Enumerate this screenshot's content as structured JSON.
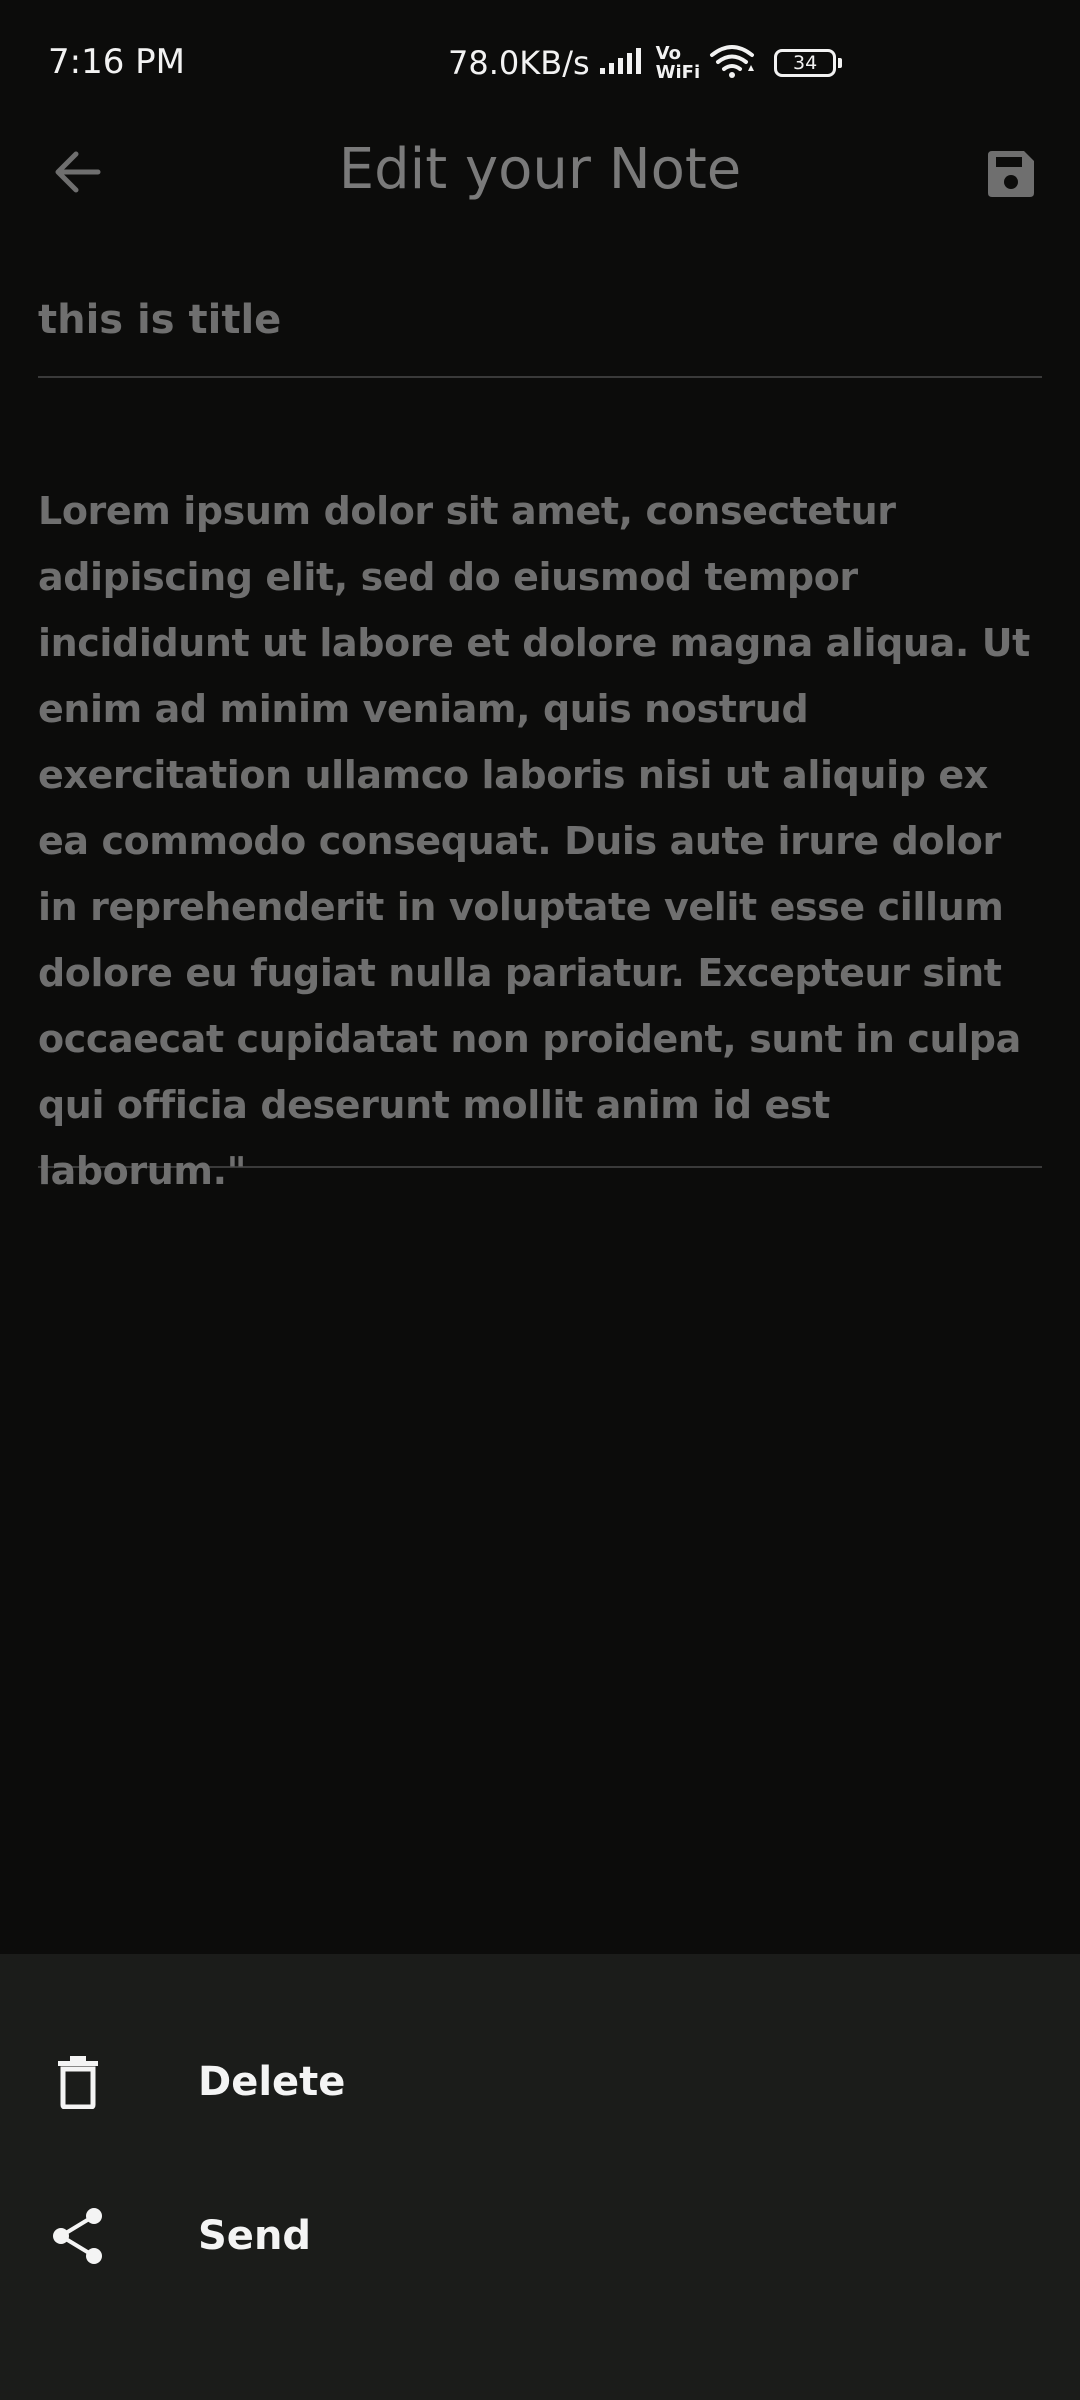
{
  "status_bar": {
    "time": "7:16 PM",
    "net_speed": "78.0KB/s",
    "vowifi_top": "Vo",
    "vowifi_bottom": "WiFi",
    "battery": "34",
    "icons": [
      "signal-icon",
      "vowifi-icon",
      "wifi-icon",
      "battery-icon"
    ]
  },
  "app_bar": {
    "title": "Edit your Note",
    "back_icon": "arrow-left-icon",
    "save_icon": "save-floppy-icon"
  },
  "note": {
    "title": "this is title",
    "body": "Lorem ipsum dolor sit amet, consectetur adipiscing elit, sed do eiusmod tempor incididunt ut labore et dolore magna aliqua. Ut enim ad minim veniam, quis nostrud exercitation ullamco laboris nisi ut aliquip ex ea commodo consequat. Duis aute irure dolor in reprehenderit in voluptate velit esse cillum dolore eu fugiat nulla pariatur. Excepteur sint occaecat cupidatat non proident, sunt in culpa qui officia deserunt mollit anim id est laborum.\""
  },
  "bottom_sheet": {
    "items": [
      {
        "label": "Delete",
        "icon": "trash-icon"
      },
      {
        "label": "Send",
        "icon": "share-icon"
      }
    ]
  },
  "colors": {
    "background": "#0c0c0b",
    "sheet": "#1b1c1a",
    "muted_text": "#6f6f6f",
    "title_text": "#7a7a7a",
    "bright_text": "#f4f4f4"
  }
}
